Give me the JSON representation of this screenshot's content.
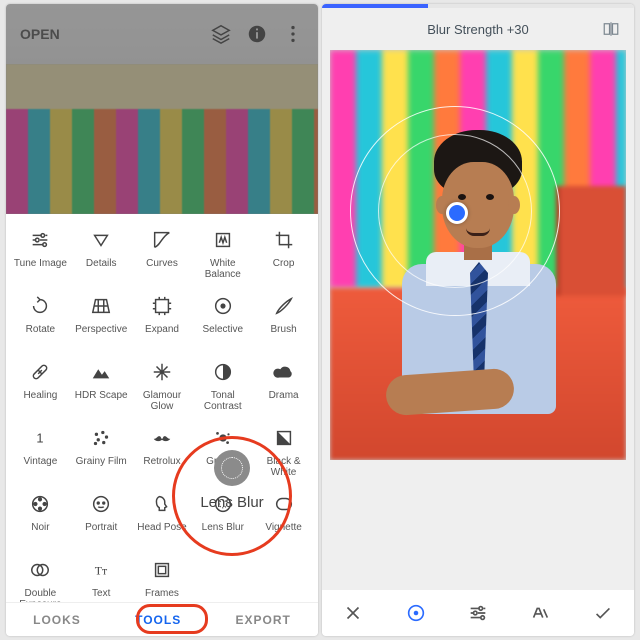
{
  "left": {
    "open_label": "OPEN",
    "header_icons": [
      "layers-icon",
      "info-icon",
      "more-vert-icon"
    ],
    "tools": [
      {
        "id": "tune-image",
        "label": "Tune Image"
      },
      {
        "id": "details",
        "label": "Details"
      },
      {
        "id": "curves",
        "label": "Curves"
      },
      {
        "id": "white-balance",
        "label": "White\nBalance"
      },
      {
        "id": "crop",
        "label": "Crop"
      },
      {
        "id": "rotate",
        "label": "Rotate"
      },
      {
        "id": "perspective",
        "label": "Perspective"
      },
      {
        "id": "expand",
        "label": "Expand"
      },
      {
        "id": "selective",
        "label": "Selective"
      },
      {
        "id": "brush",
        "label": "Brush"
      },
      {
        "id": "healing",
        "label": "Healing"
      },
      {
        "id": "hdr-scape",
        "label": "HDR Scape"
      },
      {
        "id": "glamour-glow",
        "label": "Glamour\nGlow"
      },
      {
        "id": "tonal-contrast",
        "label": "Tonal\nContrast"
      },
      {
        "id": "drama",
        "label": "Drama"
      },
      {
        "id": "vintage",
        "label": "Vintage"
      },
      {
        "id": "grainy-film",
        "label": "Grainy Film"
      },
      {
        "id": "retrolux",
        "label": "Retrolux"
      },
      {
        "id": "grunge",
        "label": "Grunge"
      },
      {
        "id": "black-white",
        "label": "Black &\nWhite"
      },
      {
        "id": "noir",
        "label": "Noir"
      },
      {
        "id": "portrait",
        "label": "Portrait"
      },
      {
        "id": "head-pose",
        "label": "Head Pose"
      },
      {
        "id": "lens-blur",
        "label": "Lens Blur"
      },
      {
        "id": "vignette",
        "label": "Vignette"
      },
      {
        "id": "double-exposure",
        "label": "Double\nExposure"
      },
      {
        "id": "text",
        "label": "Text"
      },
      {
        "id": "frames",
        "label": "Frames"
      }
    ],
    "tabs": {
      "looks": "LOOKS",
      "tools": "TOOLS",
      "export": "EXPORT"
    },
    "highlight_tool_label": "Lens Blur"
  },
  "right": {
    "status_text": "Blur Strength +30",
    "progress_pct": 34,
    "toolbar_icons": [
      "close-icon",
      "focus-point-icon",
      "adjust-sliders-icon",
      "styles-icon",
      "apply-check-icon"
    ]
  }
}
